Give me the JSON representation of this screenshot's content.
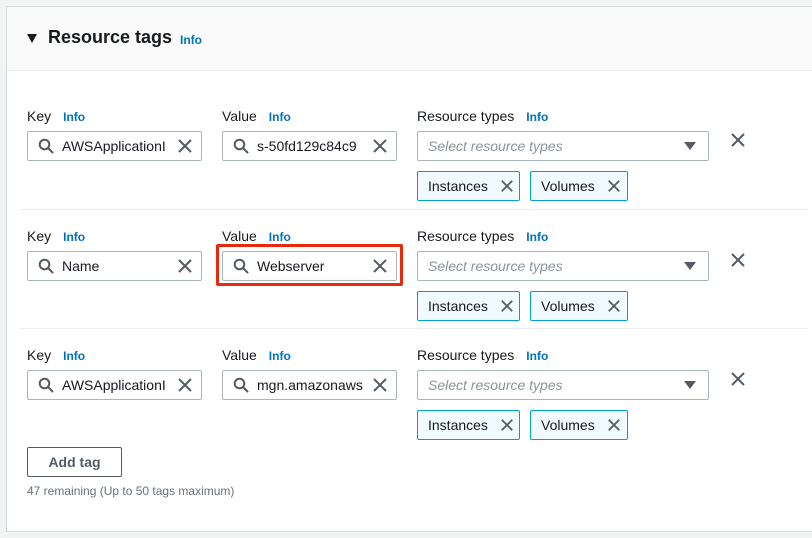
{
  "section": {
    "title": "Resource tags",
    "info_label": "Info"
  },
  "labels": {
    "key": "Key",
    "value": "Value",
    "resource_types": "Resource types",
    "info": "Info"
  },
  "tags": [
    {
      "key": "AWSApplicationI",
      "value": "s-50fd129c84c9",
      "resource_types_placeholder": "Select resource types",
      "tokens": [
        "Instances",
        "Volumes"
      ]
    },
    {
      "key": "Name",
      "value": "Webserver",
      "resource_types_placeholder": "Select resource types",
      "tokens": [
        "Instances",
        "Volumes"
      ]
    },
    {
      "key": "AWSApplicationI",
      "value": "mgn.amazonaws",
      "resource_types_placeholder": "Select resource types",
      "tokens": [
        "Instances",
        "Volumes"
      ]
    }
  ],
  "add_tag_label": "Add tag",
  "remaining_text": "47 remaining (Up to 50 tags maximum)",
  "colors": {
    "link": "#0073bb",
    "token_border": "#00a1c9",
    "token_bg": "#f1faff",
    "highlight": "#e8290b"
  },
  "highlighted_field": "tags.1.value"
}
